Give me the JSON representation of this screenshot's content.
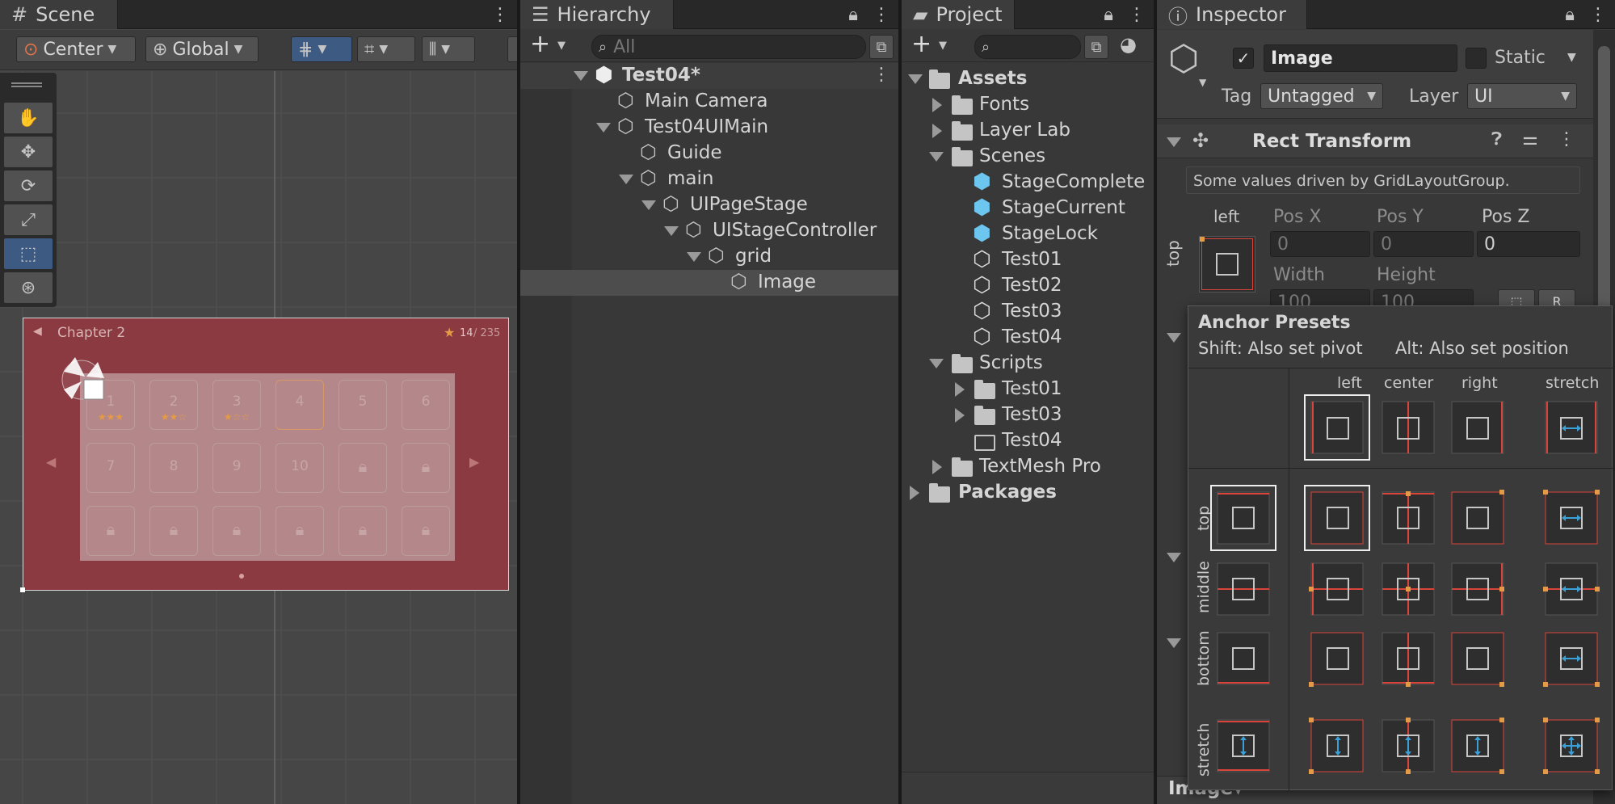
{
  "scene": {
    "tab_label": "Scene",
    "toolbar": {
      "pivot_label": "Center",
      "space_label": "Global"
    },
    "tools": [
      "hand-icon",
      "move-icon",
      "rotate-icon",
      "scale-icon",
      "rect-icon",
      "transform-icon"
    ],
    "game": {
      "chapter": "Chapter 2",
      "star_count": "14",
      "star_total": "/ 235",
      "levels_row1": [
        "1",
        "2",
        "3",
        "4",
        "5",
        "6"
      ],
      "levels_row2": [
        "7",
        "8",
        "9",
        "10",
        "",
        ""
      ],
      "stars_row1": [
        "★★★",
        "★★☆",
        "★☆☆",
        "",
        "",
        ""
      ]
    }
  },
  "hierarchy": {
    "tab_label": "Hierarchy",
    "search_placeholder": "All",
    "items": [
      {
        "label": "Test04*",
        "bold": true
      },
      {
        "label": "Main Camera"
      },
      {
        "label": "Test04UIMain"
      },
      {
        "label": "Guide"
      },
      {
        "label": "main"
      },
      {
        "label": "UIPageStage"
      },
      {
        "label": "UIStageController"
      },
      {
        "label": "grid"
      },
      {
        "label": "Image"
      }
    ]
  },
  "project": {
    "tab_label": "Project",
    "items": [
      {
        "label": "Assets"
      },
      {
        "label": "Fonts"
      },
      {
        "label": "Layer Lab"
      },
      {
        "label": "Scenes"
      },
      {
        "label": "StageComplete"
      },
      {
        "label": "StageCurrent"
      },
      {
        "label": "StageLock"
      },
      {
        "label": "Test01"
      },
      {
        "label": "Test02"
      },
      {
        "label": "Test03"
      },
      {
        "label": "Test04"
      },
      {
        "label": "Scripts"
      },
      {
        "label": "Test01"
      },
      {
        "label": "Test03"
      },
      {
        "label": "Test04"
      },
      {
        "label": "TextMesh Pro"
      },
      {
        "label": "Packages"
      }
    ]
  },
  "inspector": {
    "tab_label": "Inspector",
    "object_name": "Image",
    "static_label": "Static",
    "tag_label": "Tag",
    "tag_value": "Untagged",
    "layer_label": "Layer",
    "layer_value": "UI",
    "rect_transform_title": "Rect Transform",
    "driven_note": "Some values driven by GridLayoutGroup.",
    "anchor_h": "left",
    "anchor_v": "top",
    "pos_x_label": "Pos X",
    "pos_y_label": "Pos Y",
    "pos_z_label": "Pos Z",
    "pos_x": "0",
    "pos_y": "0",
    "pos_z": "0",
    "width_label": "Width",
    "height_label": "Height",
    "width": "100",
    "height": "100",
    "bottom_component": "Image",
    "anchor_presets": {
      "title": "Anchor Presets",
      "hint_shift": "Shift: Also set pivot",
      "hint_alt": "Alt: Also set position",
      "col_labels": [
        "left",
        "center",
        "right",
        "stretch"
      ],
      "row_labels": [
        "top",
        "middle",
        "bottom",
        "stretch"
      ]
    }
  },
  "colors": {
    "accent": "#3d5a82",
    "game_overlay": "#8a3a40",
    "anchor_red": "#d9443b",
    "anchor_blue": "#3aa0d8"
  }
}
